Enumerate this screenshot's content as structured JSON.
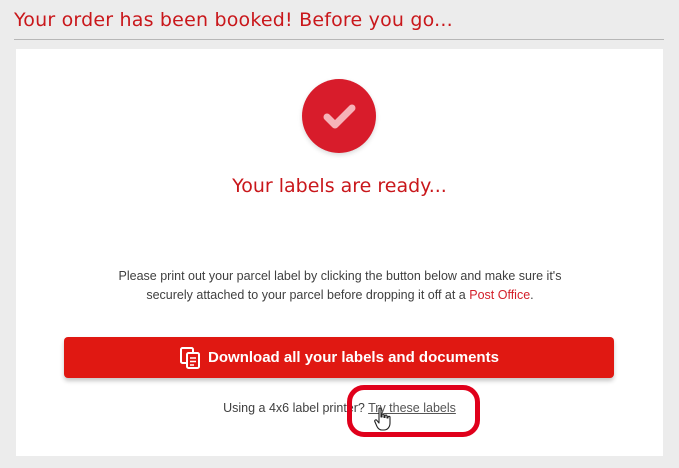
{
  "header": {
    "title": "Your order has been booked! Before you go..."
  },
  "card": {
    "status_icon": "checkmark-icon",
    "heading": "Your labels are ready...",
    "instructions": {
      "text_before_link": "Please print out your parcel label by clicking the button below and make sure it's securely attached to your parcel before dropping it off at a ",
      "link_text": "Post Office",
      "text_after_link": "."
    },
    "download_button": {
      "icon": "documents-icon",
      "label": "Download all your labels and documents"
    },
    "printer_prompt": {
      "text": "Using a 4x6 label printer?",
      "link_text": "Try these labels"
    }
  },
  "annotation": {
    "highlight_color": "#e0001b"
  },
  "colors": {
    "brand_red": "#c9171b",
    "button_red": "#e01812",
    "circle_red": "#d81c2b",
    "background": "#ececec"
  }
}
